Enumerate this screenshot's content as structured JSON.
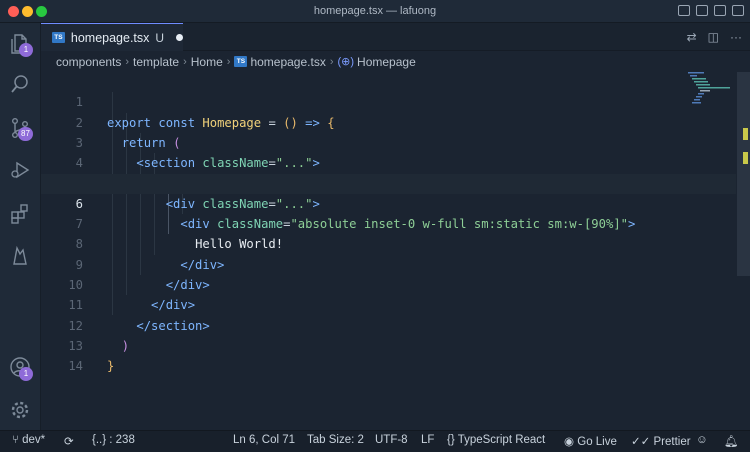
{
  "window": {
    "title": "homepage.tsx — lafuong"
  },
  "activity_bar": {
    "explorer_badge": "1",
    "source_control_badge": "87",
    "account_badge": "1"
  },
  "tab": {
    "icon_text": "TS",
    "name": "homepage.tsx",
    "status": "U"
  },
  "breadcrumb": {
    "items": [
      "components",
      "template",
      "Home",
      "homepage.tsx",
      "Homepage"
    ]
  },
  "editor": {
    "active_line": 6,
    "lines": [
      {
        "n": "1"
      },
      {
        "n": "2"
      },
      {
        "n": "3"
      },
      {
        "n": "4"
      },
      {
        "n": "5"
      },
      {
        "n": "6"
      },
      {
        "n": "7"
      },
      {
        "n": "8"
      },
      {
        "n": "9"
      },
      {
        "n": "10"
      },
      {
        "n": "11"
      },
      {
        "n": "12"
      },
      {
        "n": "13"
      },
      {
        "n": "14"
      }
    ],
    "tokens": {
      "export": "export",
      "const": "const",
      "name": "Homepage",
      "assign": "=",
      "params": "()",
      "arrow": "=>",
      "brace_open": "{",
      "return": "return",
      "paren_open": "(",
      "section_open": "<section",
      "div_open": "<div",
      "classname": "className",
      "eq": "=",
      "dots": "\"...\"",
      "gt": ">",
      "inner_class": "\"absolute inset-0 w-full sm:static sm:w-[90%]\"",
      "hello": "Hello World!",
      "div_close": "</div>",
      "section_close": "</section>",
      "paren_close": ")",
      "brace_close": "}"
    }
  },
  "status_bar": {
    "branch": "dev*",
    "sync_icon": "sync-icon",
    "symbols": "{..} : 238",
    "position": "Ln 6, Col 71",
    "tab_size": "Tab Size: 2",
    "encoding": "UTF-8",
    "eol": "LF",
    "language": "TypeScript React",
    "golive": "Go Live",
    "prettier": "Prettier"
  },
  "colors": {
    "background": "#1b2431",
    "accent": "#6f8cff",
    "badge": "#8e6bd8"
  }
}
